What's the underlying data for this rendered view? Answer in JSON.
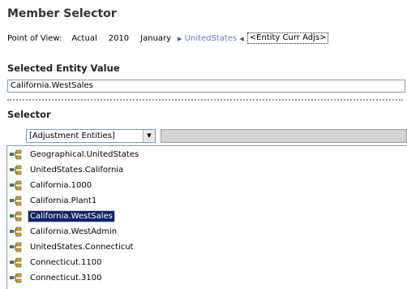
{
  "title": "Member Selector",
  "pov": {
    "label": "Point of View:",
    "items": [
      "Actual",
      "2010",
      "January"
    ],
    "link": "UnitedStates",
    "active": "<Entity Curr Adjs>"
  },
  "selected_entity": {
    "label": "Selected Entity Value",
    "value": "California.WestSales"
  },
  "selector": {
    "label": "Selector",
    "dropdown_value": "[Adjustment Entities]",
    "items": [
      {
        "label": "Geographical.UnitedStates",
        "selected": false
      },
      {
        "label": "UnitedStates.California",
        "selected": false
      },
      {
        "label": "California.1000",
        "selected": false
      },
      {
        "label": "California.Plant1",
        "selected": false
      },
      {
        "label": "California.WestSales",
        "selected": true
      },
      {
        "label": "California.WestAdmin",
        "selected": false
      },
      {
        "label": "UnitedStates.Connecticut",
        "selected": false
      },
      {
        "label": "Connecticut.1100",
        "selected": false
      },
      {
        "label": "Connecticut.3100",
        "selected": false
      }
    ]
  },
  "colors": {
    "selected_bg": "#0a246a",
    "link": "#5a7fc4"
  }
}
